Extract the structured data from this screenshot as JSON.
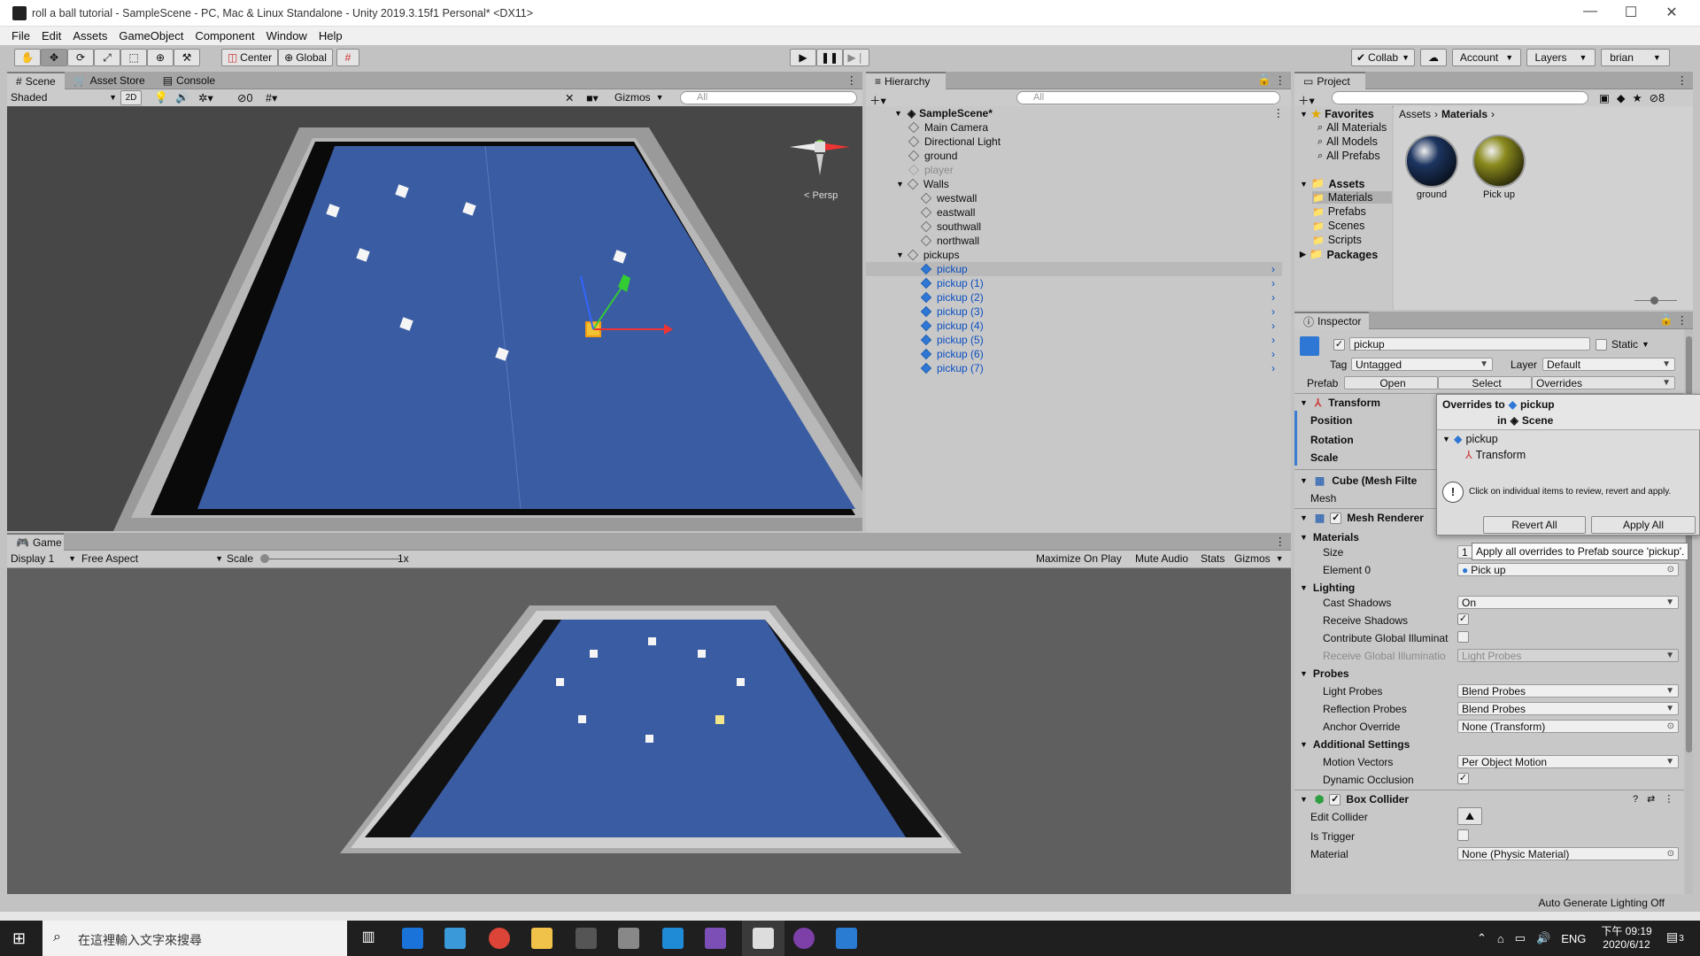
{
  "window": {
    "title": "roll a ball tutorial - SampleScene - PC, Mac & Linux Standalone - Unity 2019.3.15f1 Personal* <DX11>",
    "minimize": "—",
    "maximize": "☐",
    "close": "✕"
  },
  "menu": [
    "File",
    "Edit",
    "Assets",
    "GameObject",
    "Component",
    "Window",
    "Help"
  ],
  "toolbar": {
    "center": "Center",
    "global": "Global",
    "collab": "Collab",
    "account": "Account",
    "layers": "Layers",
    "user": "brian"
  },
  "scene_panel": {
    "tabs": [
      "Scene",
      "Asset Store",
      "Console"
    ],
    "shading": "Shaded",
    "mode_2d": "2D",
    "hidden_count": "0",
    "gizmos": "Gizmos",
    "search_placeholder": "All",
    "persp": "< Persp"
  },
  "game_panel": {
    "tab": "Game",
    "display": "Display 1",
    "aspect": "Free Aspect",
    "scale_label": "Scale",
    "scale_value": "1x",
    "maximize_on_play": "Maximize On Play",
    "mute_audio": "Mute Audio",
    "stats": "Stats",
    "gizmos": "Gizmos"
  },
  "hierarchy": {
    "tab": "Hierarchy",
    "search_placeholder": "All",
    "scene_name": "SampleScene*",
    "items": [
      {
        "label": "Main Camera",
        "style": "normal",
        "indent": 1
      },
      {
        "label": "Directional Light",
        "style": "normal",
        "indent": 1
      },
      {
        "label": "ground",
        "style": "normal",
        "indent": 1
      },
      {
        "label": "player",
        "style": "grey",
        "indent": 1
      },
      {
        "label": "Walls",
        "style": "normal",
        "indent": 1,
        "expanded": true
      },
      {
        "label": "westwall",
        "style": "normal",
        "indent": 2
      },
      {
        "label": "eastwall",
        "style": "normal",
        "indent": 2
      },
      {
        "label": "southwall",
        "style": "normal",
        "indent": 2
      },
      {
        "label": "northwall",
        "style": "normal",
        "indent": 2
      },
      {
        "label": "pickups",
        "style": "normal",
        "indent": 1,
        "expanded": true
      },
      {
        "label": "pickup",
        "style": "blue",
        "indent": 2,
        "selected": true
      },
      {
        "label": "pickup (1)",
        "style": "blue",
        "indent": 2
      },
      {
        "label": "pickup (2)",
        "style": "blue",
        "indent": 2
      },
      {
        "label": "pickup (3)",
        "style": "blue",
        "indent": 2
      },
      {
        "label": "pickup (4)",
        "style": "blue",
        "indent": 2
      },
      {
        "label": "pickup (5)",
        "style": "blue",
        "indent": 2
      },
      {
        "label": "pickup (6)",
        "style": "blue",
        "indent": 2
      },
      {
        "label": "pickup (7)",
        "style": "blue",
        "indent": 2
      }
    ]
  },
  "project": {
    "tab": "Project",
    "favorites": "Favorites",
    "fav_items": [
      "All Materials",
      "All Models",
      "All Prefabs"
    ],
    "assets": "Assets",
    "asset_folders": [
      "Materials",
      "Prefabs",
      "Scenes",
      "Scripts"
    ],
    "packages": "Packages",
    "breadcrumb_root": "Assets",
    "breadcrumb_current": "Materials",
    "hidden_count": "8",
    "materials": [
      {
        "name": "ground",
        "color": "#1d3560"
      },
      {
        "name": "Pick up",
        "color": "#8a8a1e"
      }
    ]
  },
  "inspector": {
    "tab": "Inspector",
    "object_name": "pickup",
    "static_label": "Static",
    "tag_label": "Tag",
    "tag_value": "Untagged",
    "layer_label": "Layer",
    "layer_value": "Default",
    "prefab_label": "Prefab",
    "prefab_open": "Open",
    "prefab_select": "Select",
    "prefab_overrides": "Overrides",
    "transform": {
      "title": "Transform",
      "position": "Position",
      "rotation": "Rotation",
      "scale": "Scale"
    },
    "mesh_filter": {
      "title": "Cube (Mesh Filte",
      "mesh": "Mesh"
    },
    "mesh_renderer": {
      "title": "Mesh Renderer",
      "materials": "Materials",
      "size_label": "Size",
      "size_value": "1",
      "element0_label": "Element 0",
      "element0_value": "Pick up",
      "lighting": "Lighting",
      "cast_shadows_label": "Cast Shadows",
      "cast_shadows_value": "On",
      "receive_shadows_label": "Receive Shadows",
      "contribute_gi_label": "Contribute Global Illuminat",
      "receive_gi_label": "Receive Global Illuminatio",
      "receive_gi_value": "Light Probes",
      "probes": "Probes",
      "light_probes_label": "Light Probes",
      "light_probes_value": "Blend Probes",
      "reflection_probes_label": "Reflection Probes",
      "reflection_probes_value": "Blend Probes",
      "anchor_override_label": "Anchor Override",
      "anchor_override_value": "None (Transform)",
      "additional": "Additional Settings",
      "motion_vectors_label": "Motion Vectors",
      "motion_vectors_value": "Per Object Motion",
      "dynamic_occlusion_label": "Dynamic Occlusion"
    },
    "box_collider": {
      "title": "Box Collider",
      "edit_collider": "Edit Collider",
      "is_trigger": "Is Trigger",
      "material_label": "Material",
      "material_value": "None (Physic Material)"
    }
  },
  "overrides_popup": {
    "title_prefix": "Overrides to",
    "title_object": "pickup",
    "title_in": "in",
    "title_scene": "Scene",
    "tree_root": "pickup",
    "tree_child": "Transform",
    "info": "Click on individual items to review, revert and apply.",
    "revert_all": "Revert All",
    "apply_all": "Apply All",
    "tooltip": "Apply all overrides to Prefab source 'pickup'."
  },
  "status": {
    "auto_lighting": "Auto Generate Lighting Off"
  },
  "taskbar": {
    "search_placeholder": "在這裡輸入文字來搜尋",
    "lang": "ENG",
    "time": "下午 09:19",
    "date": "2020/6/12",
    "notifications": "3"
  }
}
